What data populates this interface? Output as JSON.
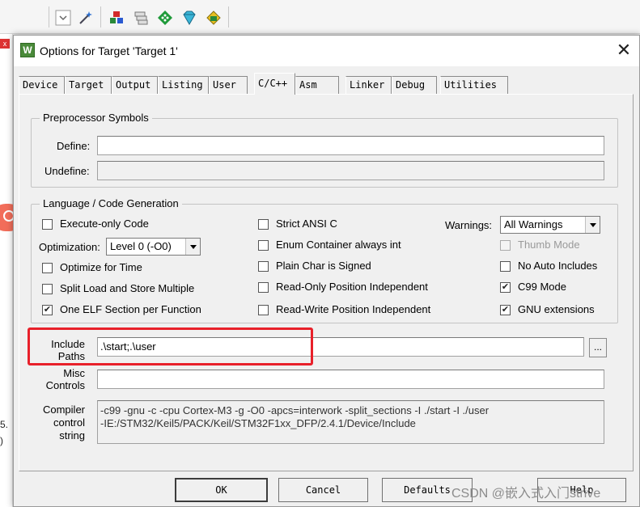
{
  "dialog": {
    "title": "Options for Target 'Target 1'",
    "app_icon_letter": "W",
    "close_glyph": "✕"
  },
  "tabs": [
    "Device",
    "Target",
    "Output",
    "Listing",
    "User",
    "C/C++",
    "Asm",
    "Linker",
    "Debug",
    "Utilities"
  ],
  "active_tab": "C/C++",
  "preprocessor": {
    "group_title": "Preprocessor Symbols",
    "define_label": "Define:",
    "define_value": "",
    "undefine_label": "Undefine:",
    "undefine_value": ""
  },
  "language": {
    "group_title": "Language / Code Generation",
    "execute_only": {
      "label": "Execute-only Code",
      "checked": false
    },
    "optimization_label": "Optimization:",
    "optimization_value": "Level 0 (-O0)",
    "optimize_for_time": {
      "label": "Optimize for Time",
      "checked": false
    },
    "split_load_store": {
      "label": "Split Load and Store Multiple",
      "checked": false
    },
    "one_elf_section": {
      "label": "One ELF Section per Function",
      "checked": true
    },
    "strict_ansi": {
      "label": "Strict ANSI C",
      "checked": false
    },
    "enum_container": {
      "label": "Enum Container always int",
      "checked": false
    },
    "plain_char_signed": {
      "label": "Plain Char is Signed",
      "checked": false
    },
    "ro_position_independent": {
      "label": "Read-Only Position Independent",
      "checked": false
    },
    "rw_position_independent": {
      "label": "Read-Write Position Independent",
      "checked": false
    },
    "warnings_label": "Warnings:",
    "warnings_value": "All Warnings",
    "thumb_mode": {
      "label": "Thumb Mode",
      "checked": false,
      "disabled": true
    },
    "no_auto_includes": {
      "label": "No Auto Includes",
      "checked": false
    },
    "c99_mode": {
      "label": "C99 Mode",
      "checked": true
    },
    "gnu_extensions": {
      "label": "GNU extensions",
      "checked": true
    }
  },
  "include_paths": {
    "label_line1": "Include",
    "label_line2": "Paths",
    "value": ".\\start;.\\user",
    "browse_label": "..."
  },
  "misc_controls": {
    "label_line1": "Misc",
    "label_line2": "Controls",
    "value": ""
  },
  "compiler_control": {
    "label_line1": "Compiler",
    "label_line2": "control",
    "label_line3": "string",
    "line1": "-c99 -gnu -c -cpu Cortex-M3 -g -O0 -apcs=interwork -split_sections -I ./start -I ./user",
    "line2": "-IE:/STM32/Keil5/PACK/Keil/STM32F1xx_DFP/2.4.1/Device/Include"
  },
  "buttons": {
    "ok": "OK",
    "cancel": "Cancel",
    "defaults": "Defaults",
    "help": "Help"
  },
  "watermark": "CSDN @嵌入式入门strive",
  "background": {
    "close_badge": "x",
    "frag1": "5.",
    "frag2": ")"
  },
  "colors": {
    "highlight": "#e8202a",
    "search_bubble": "#f26d5a"
  }
}
